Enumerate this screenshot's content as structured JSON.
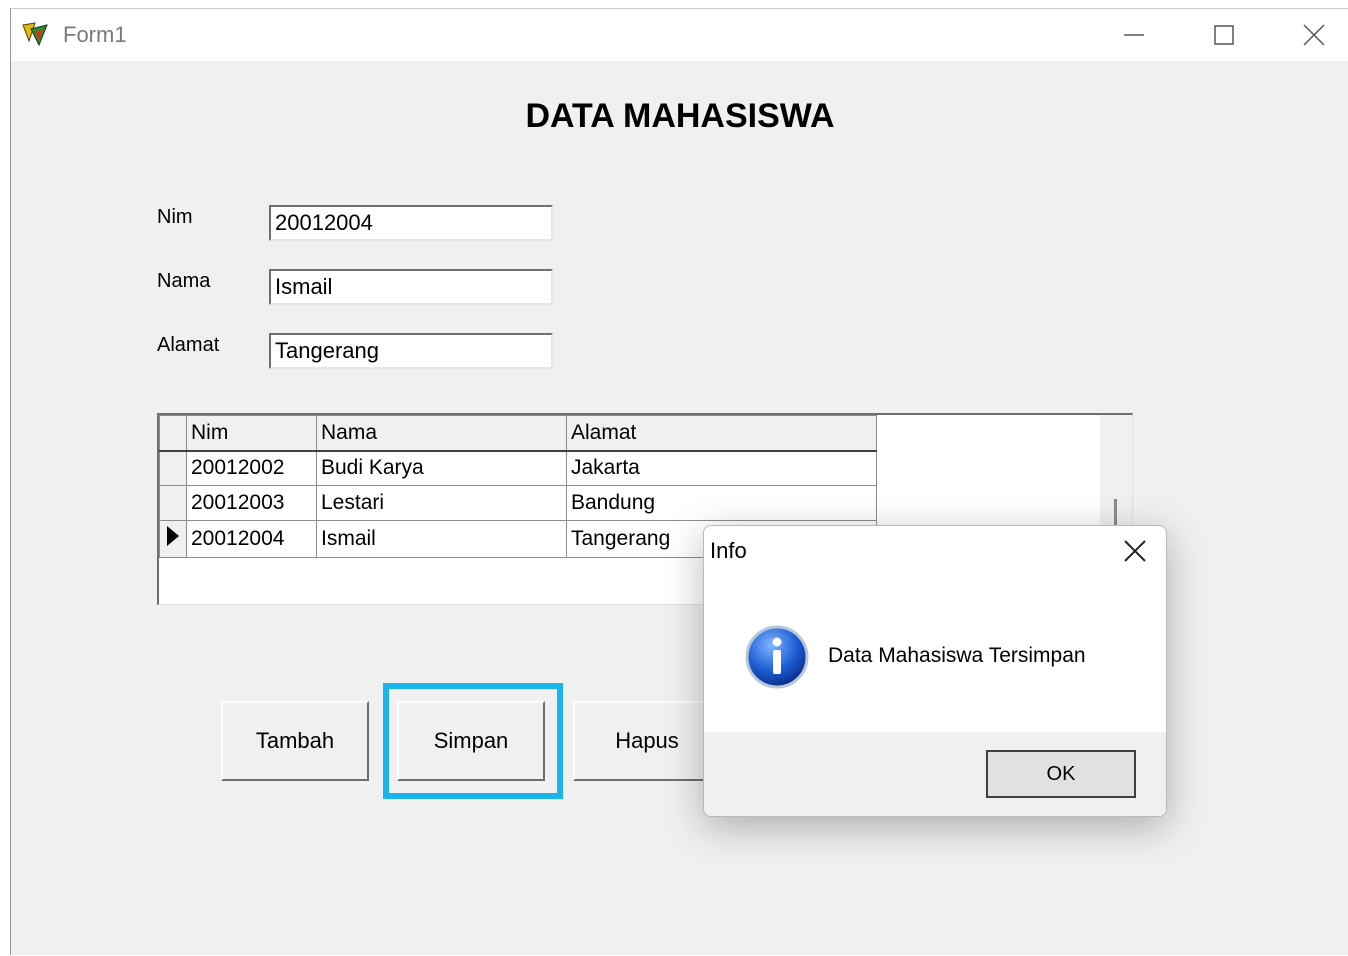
{
  "window": {
    "title": "Form1"
  },
  "form": {
    "heading": "DATA MAHASISWA",
    "fields": [
      {
        "label": "Nim",
        "value": "20012004"
      },
      {
        "label": "Nama",
        "value": "Ismail"
      },
      {
        "label": "Alamat",
        "value": "Tangerang"
      }
    ]
  },
  "grid": {
    "columns": [
      "Nim",
      "Nama",
      "Alamat"
    ],
    "rows": [
      {
        "nim": "20012002",
        "nama": "Budi Karya",
        "alamat": "Jakarta"
      },
      {
        "nim": "20012003",
        "nama": "Lestari",
        "alamat": "Bandung"
      },
      {
        "nim": "20012004",
        "nama": "Ismail",
        "alamat": "Tangerang"
      }
    ],
    "current_row": 3
  },
  "buttons": {
    "tambah": "Tambah",
    "simpan": "Simpan",
    "hapus": "Hapus"
  },
  "highlight_color": "#19b4ea",
  "dialog": {
    "title": "Info",
    "icon": "info-icon",
    "message": "Data Mahasiswa Tersimpan",
    "ok_label": "OK"
  }
}
